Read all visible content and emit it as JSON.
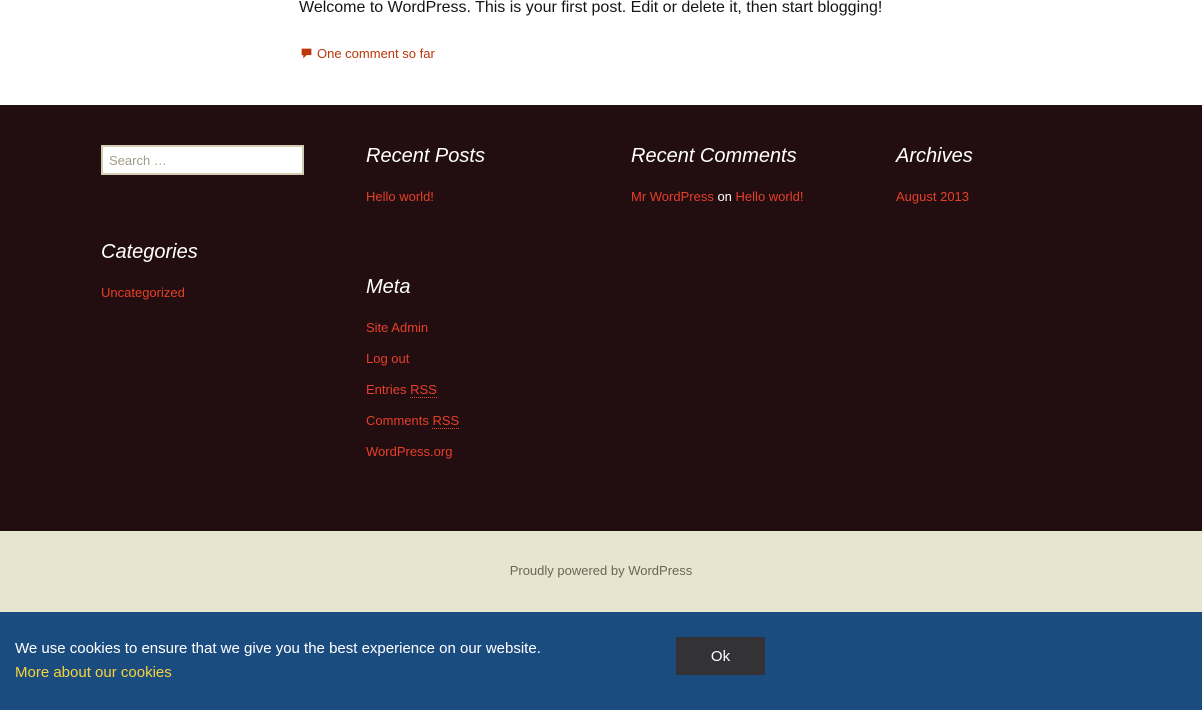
{
  "post": {
    "text": "Welcome to WordPress. This is your first post. Edit or delete it, then start blogging!",
    "comments_link": "One comment so far"
  },
  "search": {
    "placeholder": "Search …"
  },
  "widgets": {
    "recent_posts": {
      "title": "Recent Posts",
      "items": [
        "Hello world!"
      ]
    },
    "recent_comments": {
      "title": "Recent Comments",
      "author": "Mr WordPress",
      "on": "on",
      "post": "Hello world!"
    },
    "archives": {
      "title": "Archives",
      "items": [
        "August 2013"
      ]
    },
    "categories": {
      "title": "Categories",
      "items": [
        "Uncategorized"
      ]
    },
    "meta": {
      "title": "Meta",
      "site_admin": "Site Admin",
      "log_out": "Log out",
      "entries": "Entries",
      "comments": "Comments",
      "rss": "RSS",
      "wordpress_org": "WordPress.org"
    }
  },
  "footer": {
    "powered_by": "Proudly powered by WordPress"
  },
  "cookie": {
    "message": "We use cookies to ensure that we give you the best experience on our website.",
    "more_link": "More about our cookies",
    "ok_label": "Ok"
  },
  "colors": {
    "link_accent": "#e63f2a",
    "widget_background": "#220e10",
    "site_info_background": "#e8e5ce",
    "cookie_background": "#1b4c80",
    "cookie_link": "#f5d33b"
  }
}
